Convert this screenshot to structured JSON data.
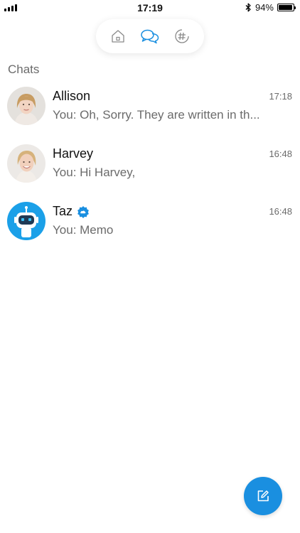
{
  "status_bar": {
    "time": "17:19",
    "battery_text": "94%",
    "battery_level": 0.94,
    "icons": [
      "signal-icon",
      "bluetooth-icon",
      "battery-icon"
    ]
  },
  "nav": {
    "items": [
      {
        "name": "home",
        "icon": "home-icon",
        "active": false
      },
      {
        "name": "chats",
        "icon": "chat-bubbles-icon",
        "active": true
      },
      {
        "name": "channels",
        "icon": "hashtag-icon",
        "active": false
      }
    ]
  },
  "section": {
    "title": "Chats"
  },
  "chats": [
    {
      "name": "Allison",
      "time": "17:18",
      "preview": "You: Oh, Sorry. They are written in th...",
      "avatar": "allison-avatar",
      "verified": false
    },
    {
      "name": "Harvey",
      "time": "16:48",
      "preview": "You: Hi Harvey,",
      "avatar": "harvey-avatar",
      "verified": false
    },
    {
      "name": "Taz",
      "time": "16:48",
      "preview": "You: Memo",
      "avatar": "bot-avatar",
      "verified": true
    }
  ],
  "fab": {
    "icon": "compose-icon"
  },
  "colors": {
    "accent": "#1a8fe0",
    "text_secondary": "#6b6b6b",
    "verified_badge": "#1a8fe0"
  }
}
